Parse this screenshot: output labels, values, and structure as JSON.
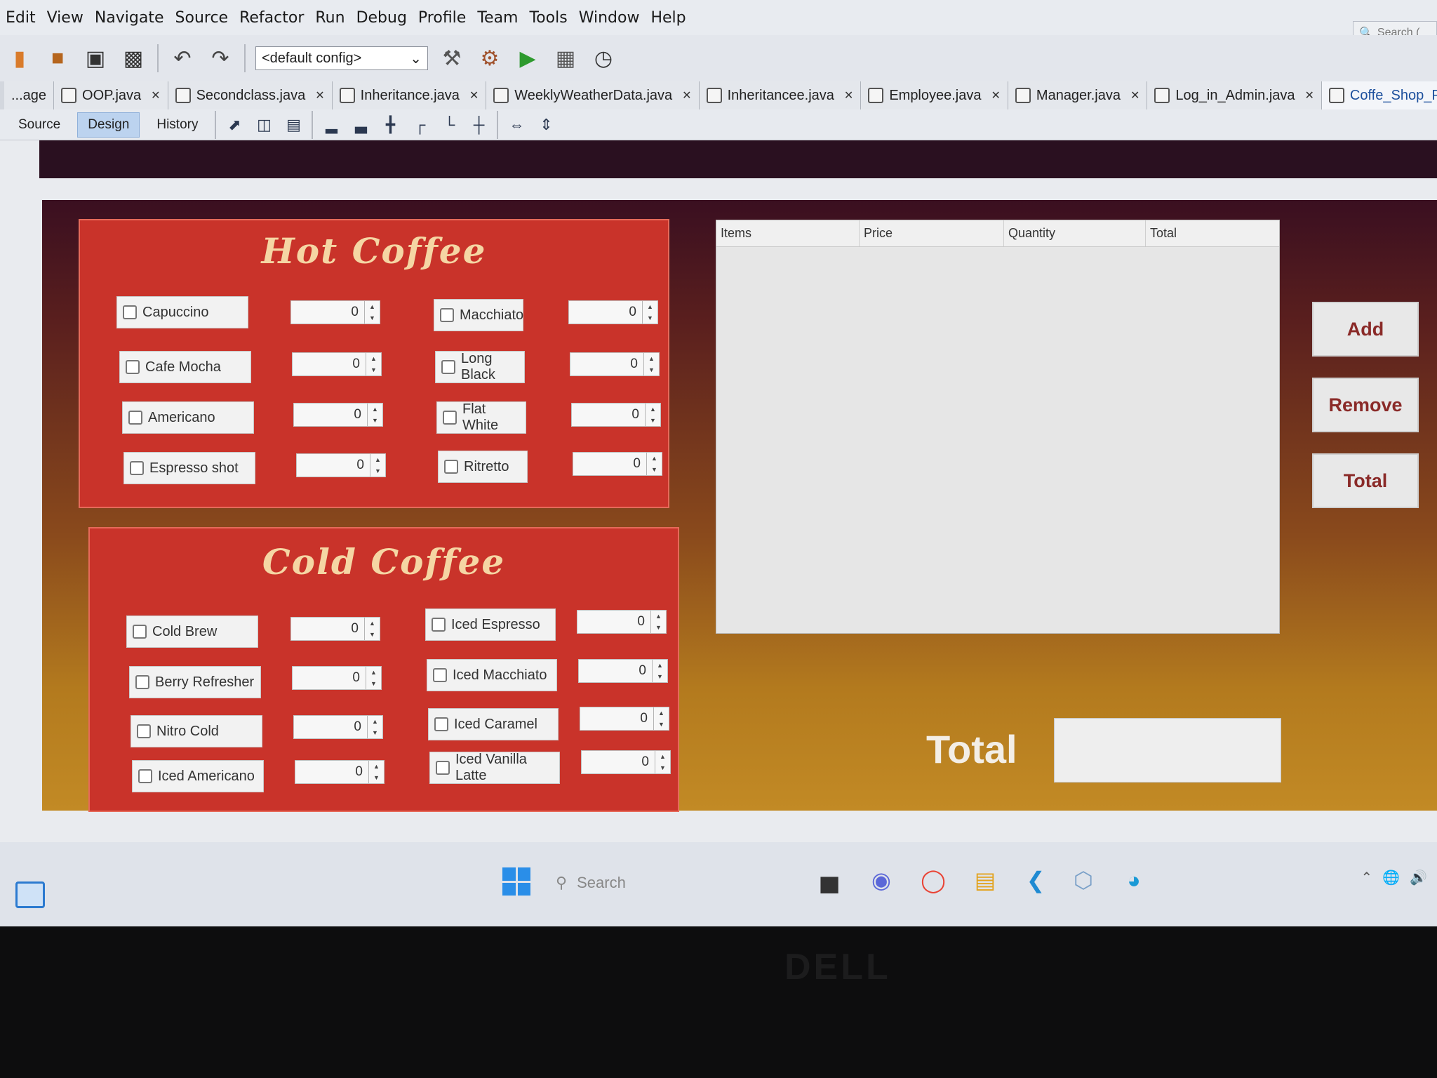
{
  "menu": [
    "Edit",
    "View",
    "Navigate",
    "Source",
    "Refactor",
    "Run",
    "Debug",
    "Profile",
    "Team",
    "Tools",
    "Window",
    "Help"
  ],
  "ide_search_placeholder": "Search (",
  "toolbar": {
    "config": "<default config>"
  },
  "tabs": [
    "...age",
    "OOP.java",
    "Secondclass.java",
    "Inheritance.java",
    "WeeklyWeatherData.java",
    "Inheritancee.java",
    "Employee.java",
    "Manager.java",
    "Log_in_Admin.java",
    "Coffe_Shop_Pos.java"
  ],
  "subtabs": [
    "Source",
    "Design",
    "History"
  ],
  "hot": {
    "title": "Hot Coffee",
    "items": [
      {
        "label": "Capuccino",
        "qty": "0"
      },
      {
        "label": "Macchiato",
        "qty": "0"
      },
      {
        "label": "Cafe Mocha",
        "qty": "0"
      },
      {
        "label": "Long Black",
        "qty": "0"
      },
      {
        "label": "Americano",
        "qty": "0"
      },
      {
        "label": "Flat White",
        "qty": "0"
      },
      {
        "label": "Espresso shot",
        "qty": "0"
      },
      {
        "label": "Ritretto",
        "qty": "0"
      }
    ]
  },
  "cold": {
    "title": "Cold Coffee",
    "items": [
      {
        "label": "Cold Brew",
        "qty": "0"
      },
      {
        "label": "Iced Espresso",
        "qty": "0"
      },
      {
        "label": "Berry Refresher",
        "qty": "0"
      },
      {
        "label": "Iced Macchiato",
        "qty": "0"
      },
      {
        "label": "Nitro Cold",
        "qty": "0"
      },
      {
        "label": "Iced Caramel",
        "qty": "0"
      },
      {
        "label": "Iced Americano",
        "qty": "0"
      },
      {
        "label": "Iced Vanilla Latte",
        "qty": "0"
      }
    ]
  },
  "table": {
    "columns": [
      "Items",
      "Price",
      "Quantity",
      "Total"
    ]
  },
  "buttons": {
    "add": "Add",
    "remove": "Remove",
    "total": "Total"
  },
  "total_label": "Total",
  "taskbar": {
    "search_placeholder": "Search"
  },
  "brand": "DELL"
}
